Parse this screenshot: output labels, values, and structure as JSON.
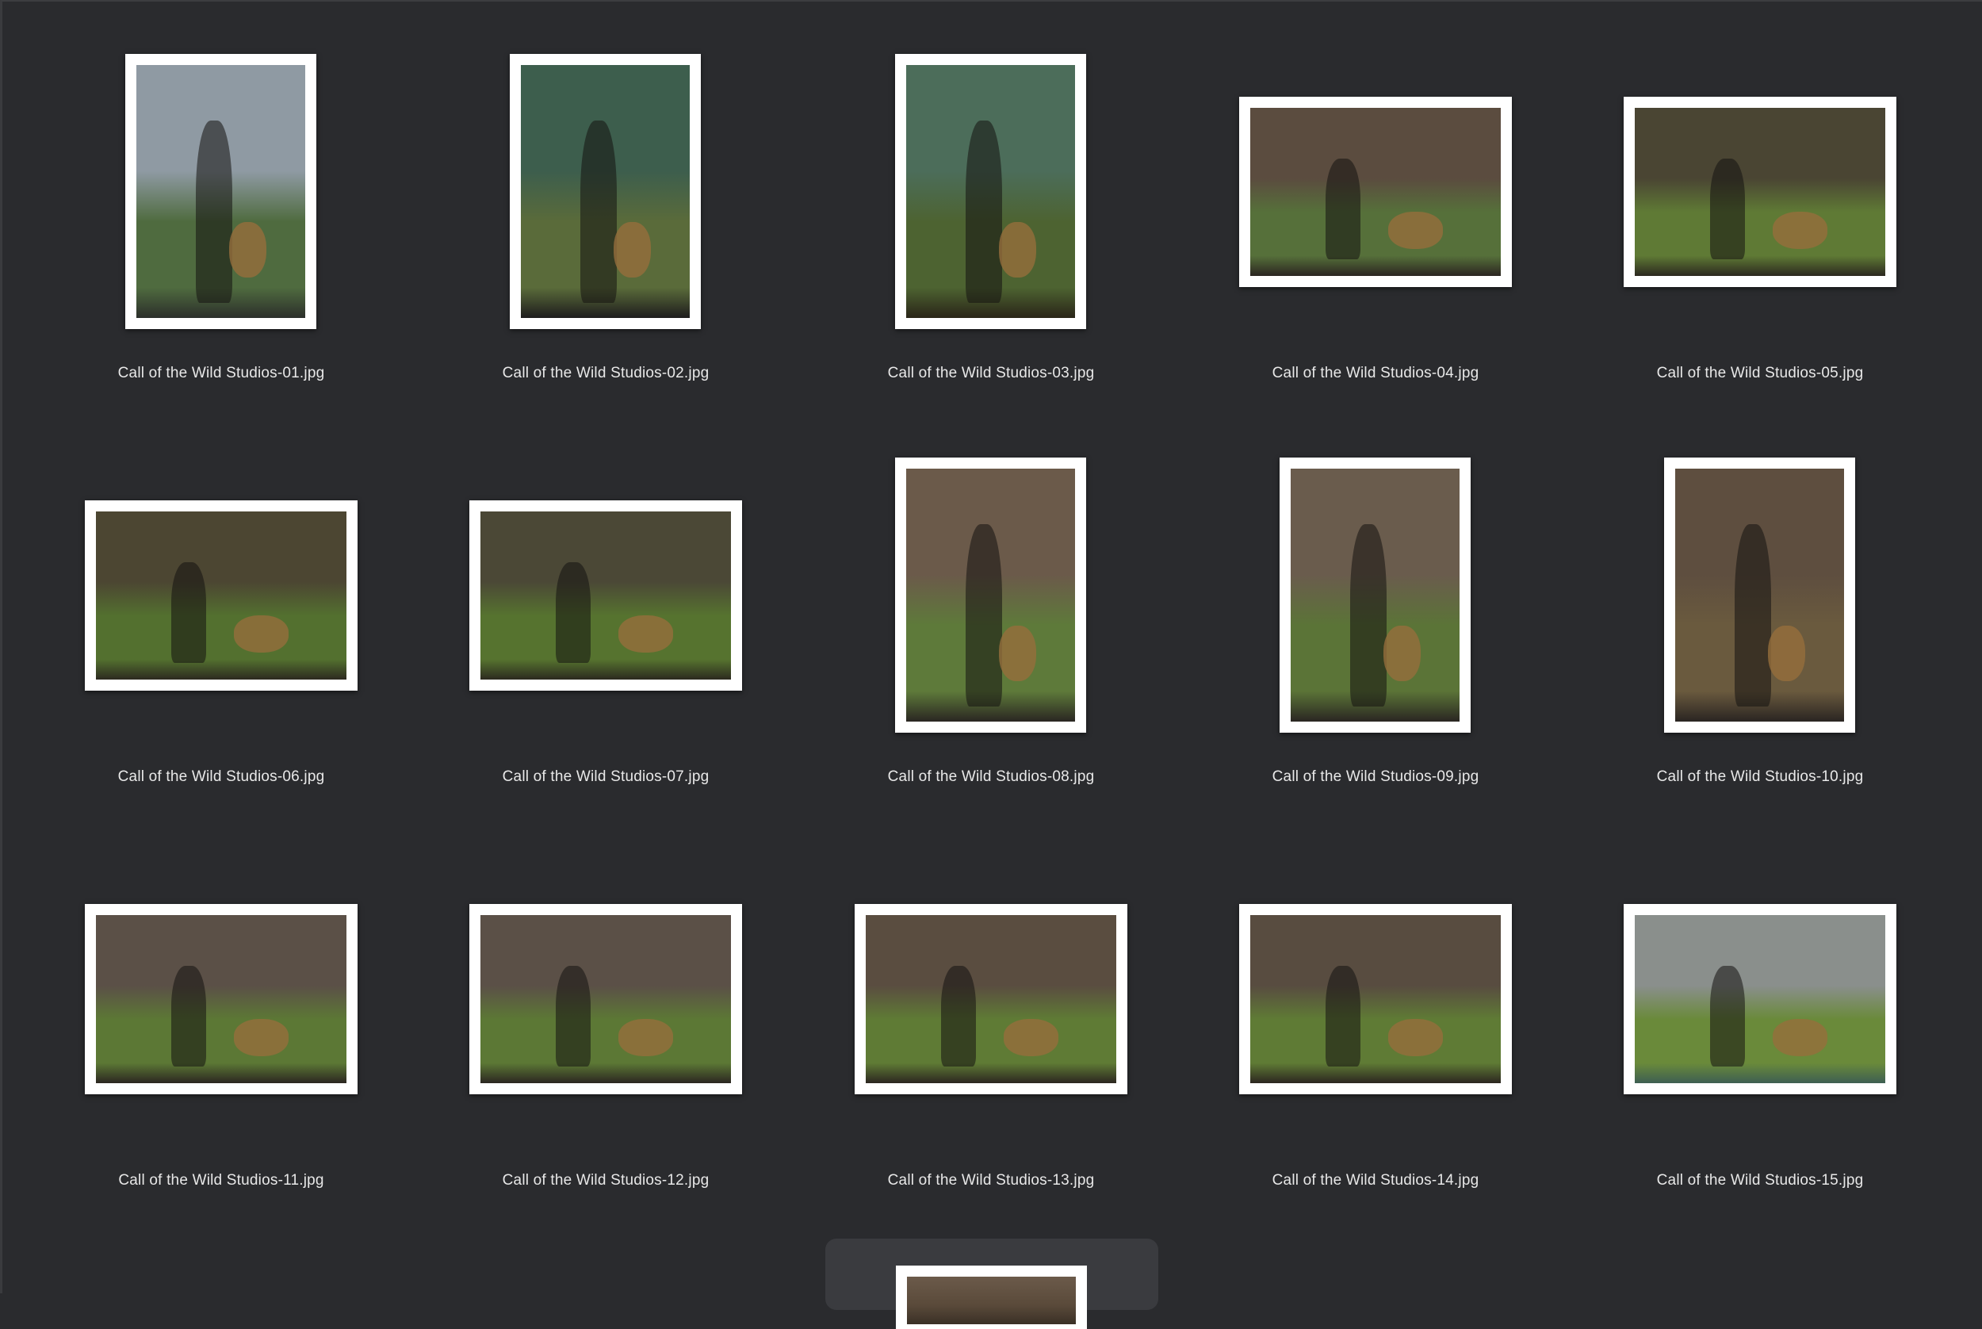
{
  "window": {
    "background": "#2a2b2e"
  },
  "items": [
    {
      "label": "Call of the Wild Studios-01.jpg",
      "orientation": "portrait",
      "palette": [
        "#8f9aa3",
        "#4f6b3f",
        "#2c2f2b"
      ]
    },
    {
      "label": "Call of the Wild Studios-02.jpg",
      "orientation": "portrait",
      "palette": [
        "#3d5e4d",
        "#5a6b3a",
        "#1e1d1d"
      ]
    },
    {
      "label": "Call of the Wild Studios-03.jpg",
      "orientation": "portrait",
      "palette": [
        "#4c6d5a",
        "#4d6331",
        "#2a2518"
      ]
    },
    {
      "label": "Call of the Wild Studios-04.jpg",
      "orientation": "landscape",
      "palette": [
        "#5b4c3f",
        "#56703a",
        "#2b2521"
      ]
    },
    {
      "label": "Call of the Wild Studios-05.jpg",
      "orientation": "landscape",
      "palette": [
        "#4a4533",
        "#5f7a35",
        "#2c281f"
      ]
    },
    {
      "label": "Call of the Wild Studios-06.jpg",
      "orientation": "landscape",
      "palette": [
        "#4c4632",
        "#53702f",
        "#2d2a20"
      ]
    },
    {
      "label": "Call of the Wild Studios-07.jpg",
      "orientation": "landscape",
      "palette": [
        "#4b4836",
        "#56732f",
        "#2c2a1f"
      ]
    },
    {
      "label": "Call of the Wild Studios-08.jpg",
      "orientation": "portrait",
      "palette": [
        "#6b5a4a",
        "#5e7a3a",
        "#2a2622"
      ]
    },
    {
      "label": "Call of the Wild Studios-09.jpg",
      "orientation": "portrait",
      "palette": [
        "#6a5c4d",
        "#5b7437",
        "#2a2622"
      ]
    },
    {
      "label": "Call of the Wild Studios-10.jpg",
      "orientation": "portrait",
      "palette": [
        "#5e4e3f",
        "#6a5a3e",
        "#2a2522"
      ]
    },
    {
      "label": "Call of the Wild Studios-11.jpg",
      "orientation": "landscape",
      "palette": [
        "#5b5047",
        "#5c7835",
        "#2b2621"
      ]
    },
    {
      "label": "Call of the Wild Studios-12.jpg",
      "orientation": "landscape",
      "palette": [
        "#5b5047",
        "#5c7835",
        "#2b2621"
      ]
    },
    {
      "label": "Call of the Wild Studios-13.jpg",
      "orientation": "landscape",
      "palette": [
        "#5a4d40",
        "#5f7b35",
        "#2c2620"
      ]
    },
    {
      "label": "Call of the Wild Studios-14.jpg",
      "orientation": "landscape",
      "palette": [
        "#584c40",
        "#5f7b35",
        "#2c2620"
      ]
    },
    {
      "label": "Call of the Wild Studios-15.jpg",
      "orientation": "landscape",
      "palette": [
        "#8a8f8c",
        "#6a8a3a",
        "#3e5f52"
      ]
    }
  ],
  "partial_item": {
    "palette": [
      "#6b5a4a",
      "#5a4a3a",
      "#3a3026"
    ]
  }
}
